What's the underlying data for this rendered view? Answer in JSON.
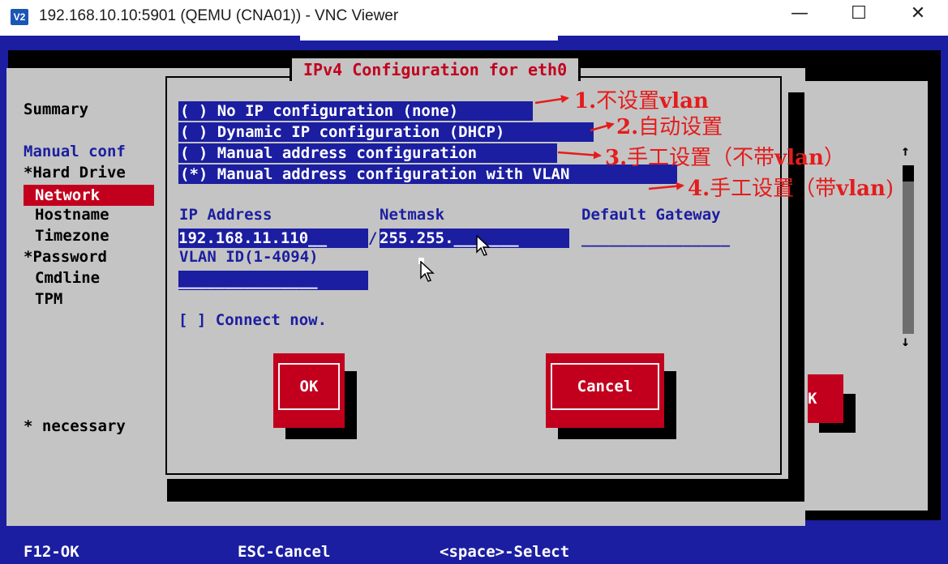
{
  "window": {
    "icon_text": "V2",
    "title": "192.168.10.10:5901 (QEMU (CNA01)) - VNC Viewer",
    "minimize_glyph": "—",
    "maximize_glyph": "☐",
    "close_glyph": "✕"
  },
  "menu": {
    "summary": "Summary",
    "manual_conf": "Manual conf",
    "items": [
      "*Hard Drive",
      "Network",
      "Hostname",
      "Timezone",
      "*Password",
      "Cmdline",
      "TPM"
    ],
    "necessary": "* necessary"
  },
  "background_ok": "K",
  "dialog": {
    "title": "IPv4 Configuration for eth0",
    "options": [
      "( ) No IP configuration (none)",
      "( ) Dynamic IP configuration (DHCP)",
      "( ) Manual address configuration",
      "(*) Manual address configuration with VLAN"
    ],
    "labels": {
      "ip": "IP Address",
      "netmask": "Netmask",
      "gateway": "Default Gateway",
      "vlan": "VLAN ID(1-4094)"
    },
    "fields": {
      "ip": "192.168.11.110__",
      "separator": "/",
      "netmask": "255.255._______",
      "gateway": "________________",
      "vlan": "_______________"
    },
    "connect_now": "[ ] Connect now.",
    "ok": "OK",
    "cancel": "Cancel"
  },
  "footer": {
    "f12": "F12-OK",
    "esc": "ESC-Cancel",
    "space": "<space>-Select"
  },
  "annotations": {
    "a1": {
      "num": "1.",
      "text": "不设置",
      "bold": "vlan"
    },
    "a2": {
      "num": "2.",
      "text": "自动设置"
    },
    "a3": {
      "num": "3.",
      "text": "手工设置（不带",
      "bold": "vlan",
      "tail": "）"
    },
    "a4": {
      "num": "4.",
      "text": "手工设置（带",
      "bold": "vlan",
      "tail": ")"
    }
  },
  "colors": {
    "screen_blue": "#1b1ea0",
    "panel_gray": "#c4c4c4",
    "accent_red": "#c2001e",
    "annotation_red": "#e51c1c"
  }
}
